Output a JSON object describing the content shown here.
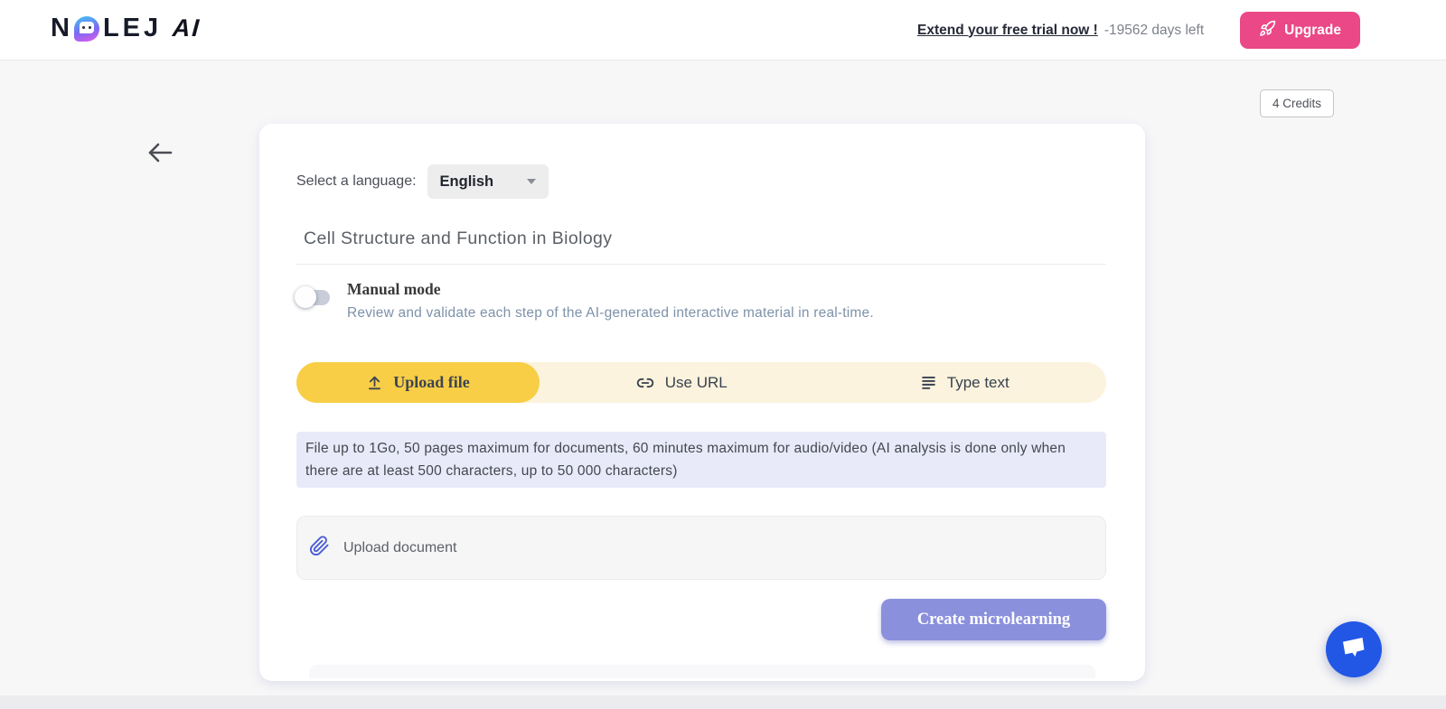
{
  "colors": {
    "active_tab_yellow": "#F8CE47",
    "tab_bar_cream": "#FBF3DD",
    "info_box_lavender": "#E8EAF9",
    "create_button_periwinkle": "#8B90DC",
    "upgrade_pink": "#EA4886",
    "chat_fab_blue": "#2257E6",
    "paperclip_indigo": "#4C5FD5"
  },
  "header": {
    "logo_part1": "N",
    "logo_o_icon": "nolej-face-icon",
    "logo_part2": "LEJ",
    "logo_suffix": "AI",
    "trial_link": "Extend your free trial now !",
    "days_left": "-19562 days left",
    "upgrade": {
      "label": "Upgrade",
      "icon": "rocket-icon"
    }
  },
  "credits_badge": "4 Credits",
  "back_icon": "back-arrow-icon",
  "form": {
    "language_label": "Select a language:",
    "language_value": "English",
    "title_value": "Cell Structure and Function in Biology",
    "manual_mode": {
      "label": "Manual mode",
      "description": "Review and validate each step of the AI-generated interactive material in real-time.",
      "enabled": false
    },
    "tabs": [
      {
        "label": "Upload file",
        "icon": "upload-icon",
        "active": true
      },
      {
        "label": "Use URL",
        "icon": "link-icon",
        "active": false
      },
      {
        "label": "Type text",
        "icon": "text-lines-icon",
        "active": false
      }
    ],
    "info_text": "File up to 1Go, 50 pages maximum for documents, 60 minutes maximum for audio/video (AI analysis is done only when there are at least 500 characters, up to 50 000 characters)",
    "upload_field": {
      "label": "Upload document",
      "icon": "paperclip-icon"
    },
    "create_button": "Create microlearning"
  },
  "chat_widget_icon": "chat-bubble-icon"
}
